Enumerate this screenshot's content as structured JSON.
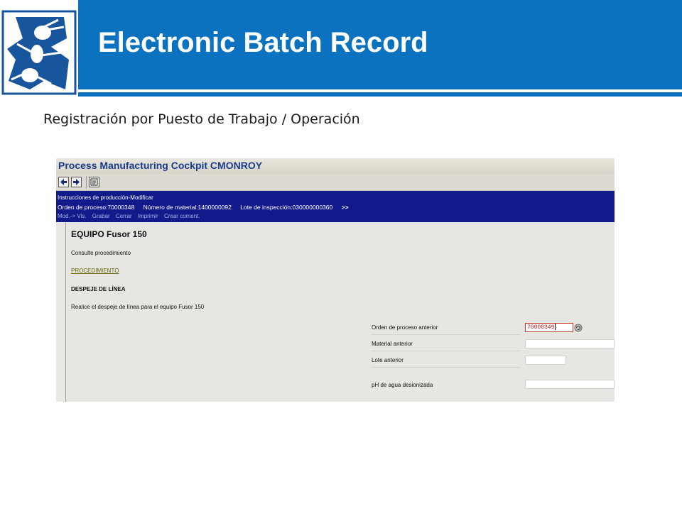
{
  "slide": {
    "title": "Electronic Batch Record",
    "subtitle": "Registración por Puesto de Trabajo / Operación",
    "colors": {
      "header_band": "#0a72bf",
      "logo_figure": "#17569c"
    },
    "logo": "ant-figure-logo"
  },
  "sap": {
    "window_title": "Process Manufacturing Cockpit CMONROY",
    "toolbar": {
      "back_icon": "arrow-left-icon",
      "forward_icon": "arrow-right-icon",
      "layout_icon": "document-icon"
    },
    "infobar": {
      "title": "Instrucciones de producción-Modificar",
      "process_order": "Orden de proceso:70000348",
      "material_number": "Número de material:1400000092",
      "inspection_lot": "Lote de inspección:030000000360",
      "more": ">>",
      "menu": [
        "Mod.-> Vis.",
        "Grabar",
        "Cerrar",
        "Imprimir",
        "Crear coment."
      ]
    },
    "content": {
      "heading": "EQUIPO Fusor 150",
      "consult": "Consulte procedimiento",
      "procedure_link": "PROCEDIMIENTO",
      "section_title": "DESPEJE DE LÍNEA",
      "instruction": "Realice el despeje de línea para el equipo Fusor 150",
      "fields": [
        {
          "label": "Orden de proceso anterior",
          "value": "70000349"
        },
        {
          "label": "Material anterior",
          "value": ""
        },
        {
          "label": "Lote anterior",
          "value": ""
        },
        {
          "label": "pH de agua desionizada",
          "value": ""
        }
      ]
    },
    "colors": {
      "infobar": "#12198a",
      "link": "#6a6400",
      "input_border_active": "#c0392b"
    }
  }
}
